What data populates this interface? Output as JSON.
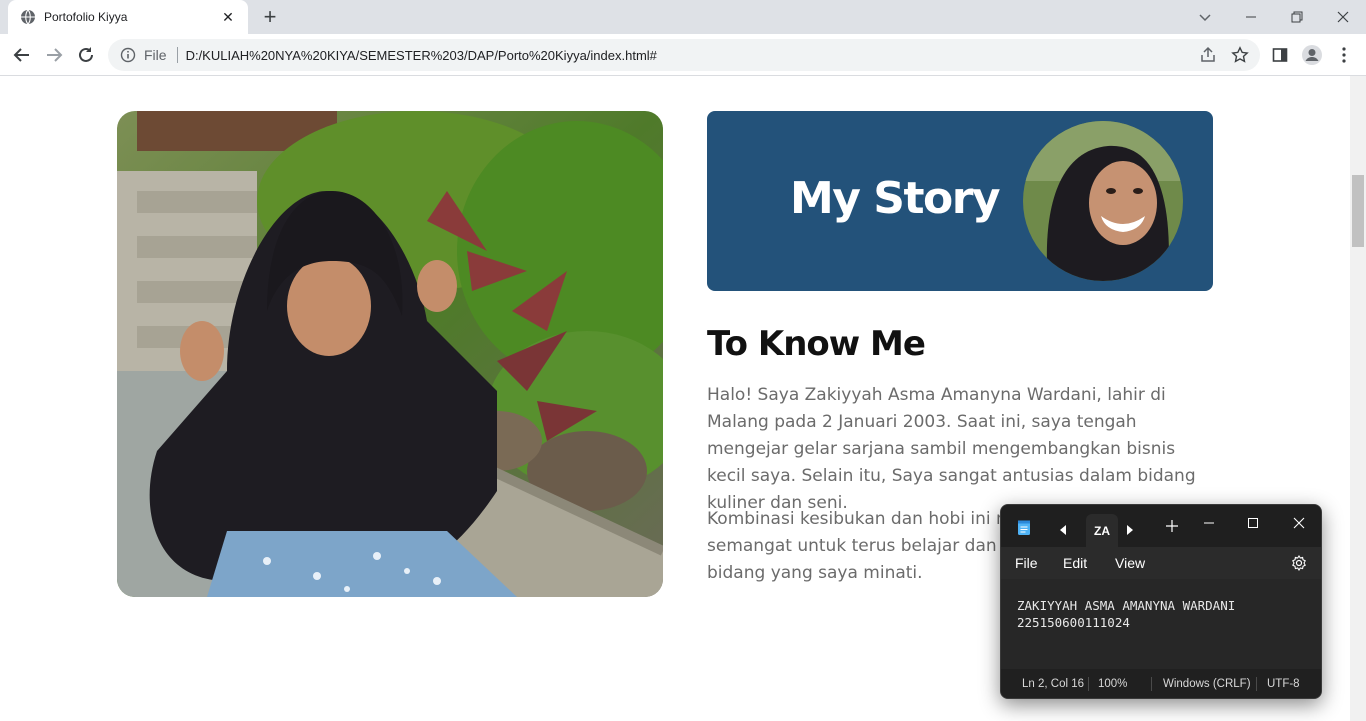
{
  "browser": {
    "tab_title": "Portofolio Kiyya",
    "address_prefix": "File",
    "url": "D:/KULIAH%20NYA%20KIYA/SEMESTER%203/DAP/Porto%20Kiyya/index.html#"
  },
  "page": {
    "story_heading": "My Story",
    "section_heading": "To Know Me",
    "paragraph1": "Halo! Saya Zakiyyah Asma Amanyna Wardani, lahir di Malang pada 2 Januari 2003. Saat ini, saya tengah mengejar gelar sarjana sambil mengembangkan bisnis kecil saya. Selain itu, Saya sangat antusias dalam bidang kuliner dan seni.",
    "paragraph2": "Kombinasi kesibukan dan hobi ini membuat saya semangat untuk terus belajar dan berkembang dalam bidang yang saya minati."
  },
  "notepad": {
    "tab_label": "ZA",
    "menu": {
      "file": "File",
      "edit": "Edit",
      "view": "View"
    },
    "line1": "ZAKIYYAH ASMA AMANYNA WARDANI",
    "line2": "225150600111024",
    "status": {
      "position": "Ln 2, Col 16",
      "zoom": "100%",
      "line_endings": "Windows (CRLF)",
      "encoding": "UTF-8"
    }
  },
  "colors": {
    "banner": "#23527a",
    "paragraph": "#6b6b6b",
    "notepad_bg": "#202020"
  }
}
